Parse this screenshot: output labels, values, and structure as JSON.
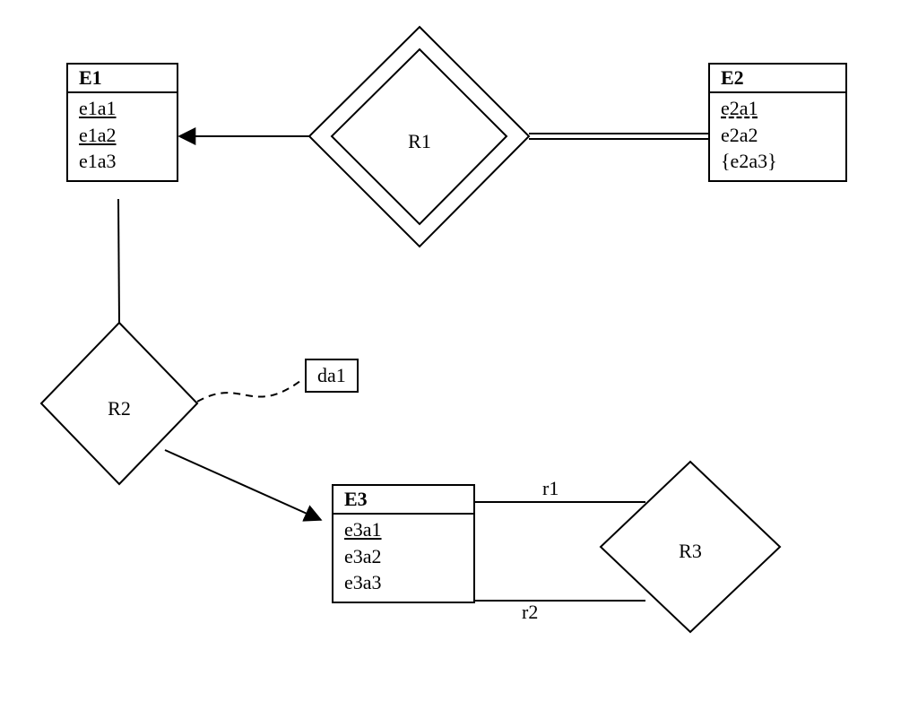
{
  "entities": {
    "E1": {
      "title": "E1",
      "attrs": [
        "e1a1",
        "e1a2",
        "e1a3"
      ],
      "keyAttrs": [
        "e1a1",
        "e1a2"
      ]
    },
    "E2": {
      "title": "E2",
      "attrs": [
        "e2a1",
        "e2a2",
        "{e2a3}"
      ],
      "partialKey": "e2a1"
    },
    "E3": {
      "title": "E3",
      "attrs": [
        "e3a1",
        "e3a2",
        "e3a3"
      ],
      "keyAttrs": [
        "e3a1"
      ]
    }
  },
  "relationships": {
    "R1": {
      "label": "R1",
      "identifying": true
    },
    "R2": {
      "label": "R2"
    },
    "R3": {
      "label": "R3"
    }
  },
  "derivedAttr": {
    "label": "da1"
  },
  "roles": {
    "r1": "r1",
    "r2": "r2"
  }
}
